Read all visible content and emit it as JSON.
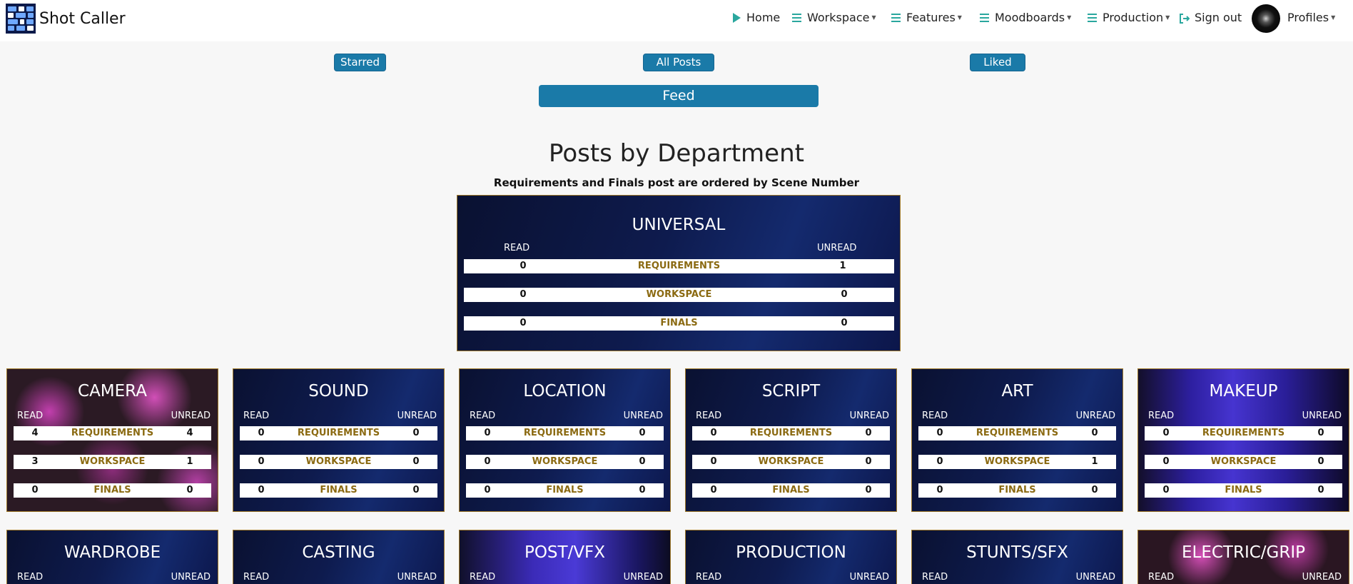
{
  "app": {
    "name": "Shot Caller"
  },
  "nav": {
    "home": "Home",
    "workspace": "Workspace",
    "features": "Features",
    "moodboards": "Moodboards",
    "production": "Production",
    "signout": "Sign out",
    "profiles": "Profiles"
  },
  "filters": {
    "starred": "Starred",
    "all_posts": "All Posts",
    "liked": "Liked"
  },
  "feed_label": "Feed",
  "section": {
    "title": "Posts by Department",
    "subtitle": "Requirements and Finals post are ordered by Scene Number"
  },
  "labels": {
    "read": "READ",
    "unread": "UNREAD",
    "requirements": "REQUIREMENTS",
    "workspace": "WORKSPACE",
    "finals": "FINALS"
  },
  "universal": {
    "name": "UNIVERSAL",
    "requirements": {
      "read": "0",
      "unread": "1"
    },
    "workspace": {
      "read": "0",
      "unread": "0"
    },
    "finals": {
      "read": "0",
      "unread": "0"
    }
  },
  "departments": [
    {
      "name": "CAMERA",
      "style": "camera",
      "requirements": {
        "read": "4",
        "unread": "4"
      },
      "workspace": {
        "read": "3",
        "unread": "1"
      },
      "finals": {
        "read": "0",
        "unread": "0"
      }
    },
    {
      "name": "SOUND",
      "style": "navy",
      "requirements": {
        "read": "0",
        "unread": "0"
      },
      "workspace": {
        "read": "0",
        "unread": "0"
      },
      "finals": {
        "read": "0",
        "unread": "0"
      }
    },
    {
      "name": "LOCATION",
      "style": "navy",
      "requirements": {
        "read": "0",
        "unread": "0"
      },
      "workspace": {
        "read": "0",
        "unread": "0"
      },
      "finals": {
        "read": "0",
        "unread": "0"
      }
    },
    {
      "name": "SCRIPT",
      "style": "navy",
      "requirements": {
        "read": "0",
        "unread": "0"
      },
      "workspace": {
        "read": "0",
        "unread": "0"
      },
      "finals": {
        "read": "0",
        "unread": "0"
      }
    },
    {
      "name": "ART",
      "style": "navy",
      "requirements": {
        "read": "0",
        "unread": "0"
      },
      "workspace": {
        "read": "0",
        "unread": "1"
      },
      "finals": {
        "read": "0",
        "unread": "0"
      }
    },
    {
      "name": "MAKEUP",
      "style": "makeup",
      "requirements": {
        "read": "0",
        "unread": "0"
      },
      "workspace": {
        "read": "0",
        "unread": "0"
      },
      "finals": {
        "read": "0",
        "unread": "0"
      }
    }
  ],
  "departments_row2": [
    {
      "name": "WARDROBE",
      "style": "navy"
    },
    {
      "name": "CASTING",
      "style": "navy"
    },
    {
      "name": "POST/VFX",
      "style": "postvfx"
    },
    {
      "name": "PRODUCTION",
      "style": "navy"
    },
    {
      "name": "STUNTS/SFX",
      "style": "navy"
    },
    {
      "name": "ELECTRIC/GRIP",
      "style": "electric"
    }
  ]
}
